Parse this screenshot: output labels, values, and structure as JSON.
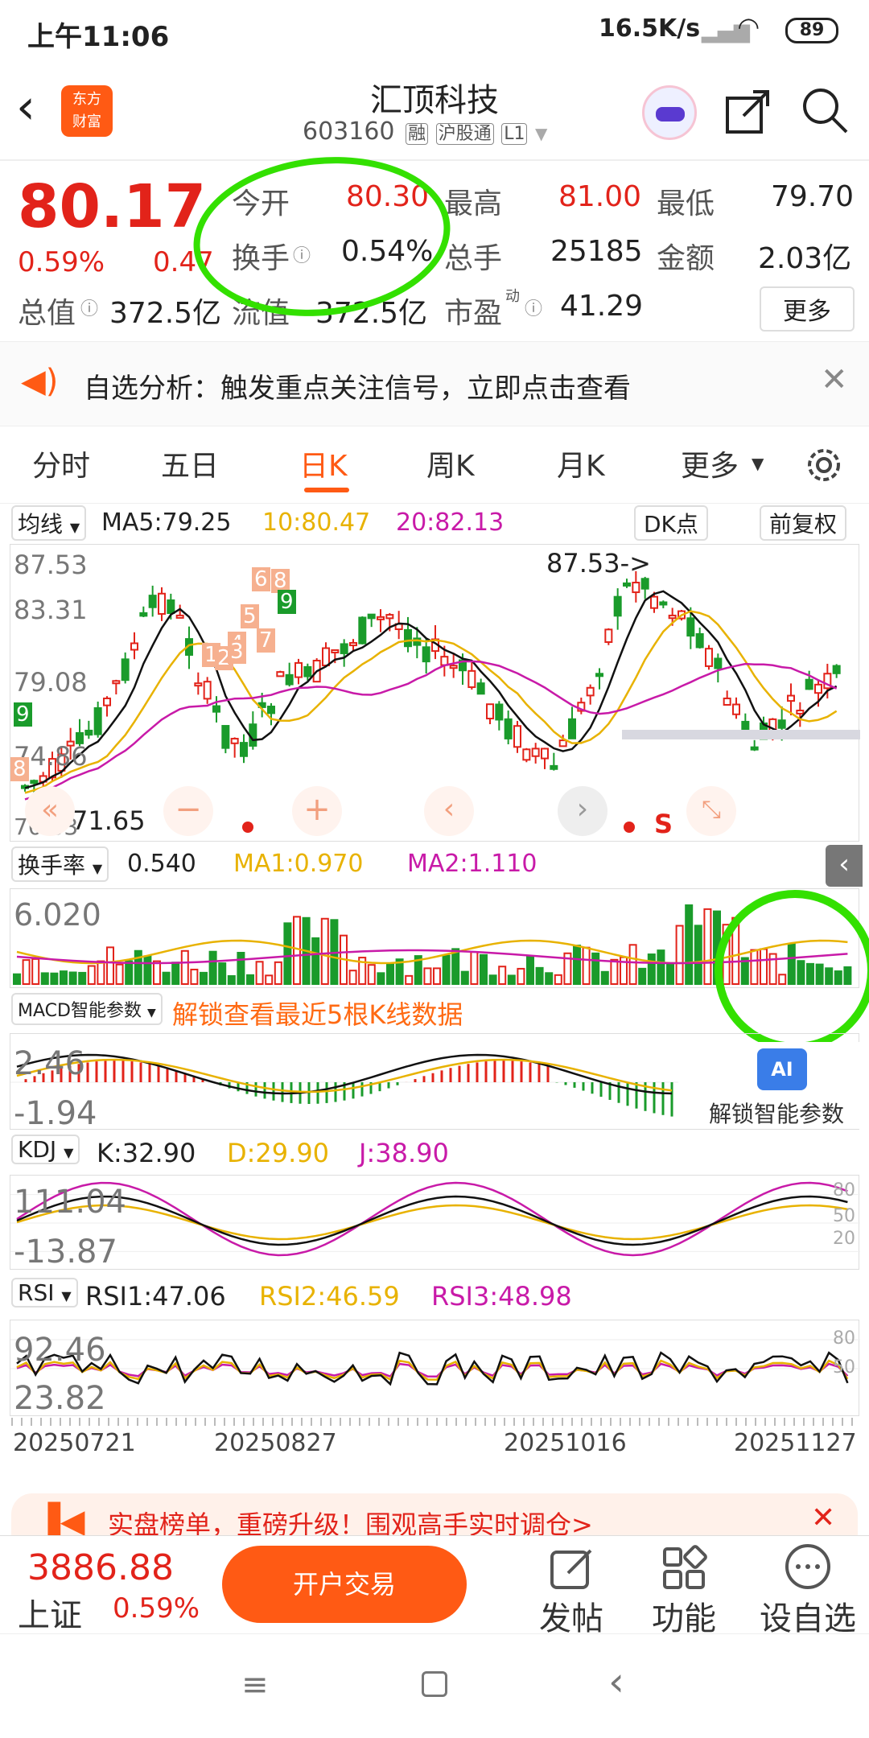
{
  "status": {
    "time": "上午11:06",
    "speed": "16.5K/s",
    "battery": "89"
  },
  "header": {
    "title": "汇顶科技",
    "code": "603160",
    "badges": [
      "融",
      "沪股通",
      "L1"
    ]
  },
  "quote": {
    "price": "80.17",
    "pct": "0.59%",
    "chg": "0.47",
    "open_label": "今开",
    "open": "80.30",
    "high_label": "最高",
    "high": "81.00",
    "low_label": "最低",
    "low": "79.70",
    "turn_label": "换手",
    "turn": "0.54%",
    "vol_label": "总手",
    "vol": "25185",
    "amt_label": "金额",
    "amt": "2.03亿",
    "mcap_label": "总值",
    "mcap": "372.5亿",
    "float_label": "流值",
    "float": "372.5亿",
    "pe_label": "市盈",
    "pe_sup": "动",
    "pe": "41.29",
    "more": "更多"
  },
  "banner": {
    "text": "自选分析：触发重点关注信号，立即点击查看"
  },
  "tabs": [
    "分时",
    "五日",
    "日K",
    "周K",
    "月K",
    "更多"
  ],
  "ma": {
    "sel": "均线",
    "ma5": "MA5:79.25",
    "ma10": "10:80.47",
    "ma20": "20:82.13",
    "dk": "DK点",
    "fq": "前复权"
  },
  "kchart": {
    "y_labels": [
      "87.53",
      "83.31",
      "79.08",
      "74.86",
      "70.63"
    ],
    "max_note": "87.53->",
    "min_note": "71.65",
    "marks": [
      "6",
      "8",
      "9",
      "5",
      "4",
      "7",
      "1",
      "2",
      "3",
      "9",
      "8"
    ],
    "s_mark": "S"
  },
  "turnover": {
    "sel": "换手率",
    "val": "0.540",
    "ma1": "MA1:0.970",
    "ma2": "MA2:1.110",
    "ymax": "6.020"
  },
  "macd": {
    "sel": "MACD智能参数",
    "unlock": "解锁查看最近5根K线数据",
    "ymax": "2.46",
    "ymin": "-1.94",
    "ai": "AI",
    "ai_text": "解锁智能参数"
  },
  "kdj": {
    "sel": "KDJ",
    "k": "K:32.90",
    "d": "D:29.90",
    "j": "J:38.90",
    "ymax": "111.04",
    "ymin": "-13.87",
    "r": [
      "80",
      "50",
      "20"
    ]
  },
  "rsi": {
    "sel": "RSI",
    "r1": "RSI1:47.06",
    "r2": "RSI2:46.59",
    "r3": "RSI3:48.98",
    "ymax": "92.46",
    "ymin": "23.82",
    "r": [
      "80",
      "50"
    ]
  },
  "dates": [
    "20250721",
    "20250827",
    "20251016",
    "20251127"
  ],
  "promo": {
    "text": "实盘榜单，重磅升级！围观高手实时调仓>"
  },
  "bottom": {
    "index_val": "3886.88",
    "index_name": "上证",
    "index_pct": "0.59%",
    "trade": "开户交易",
    "post": "发帖",
    "func": "功能",
    "addfav": "设自选"
  },
  "colors": {
    "up": "#e2231a",
    "down": "#1a9b2b",
    "brand": "#ff6a13",
    "ma10": "#e8b200",
    "ma20": "#c81aa8"
  }
}
